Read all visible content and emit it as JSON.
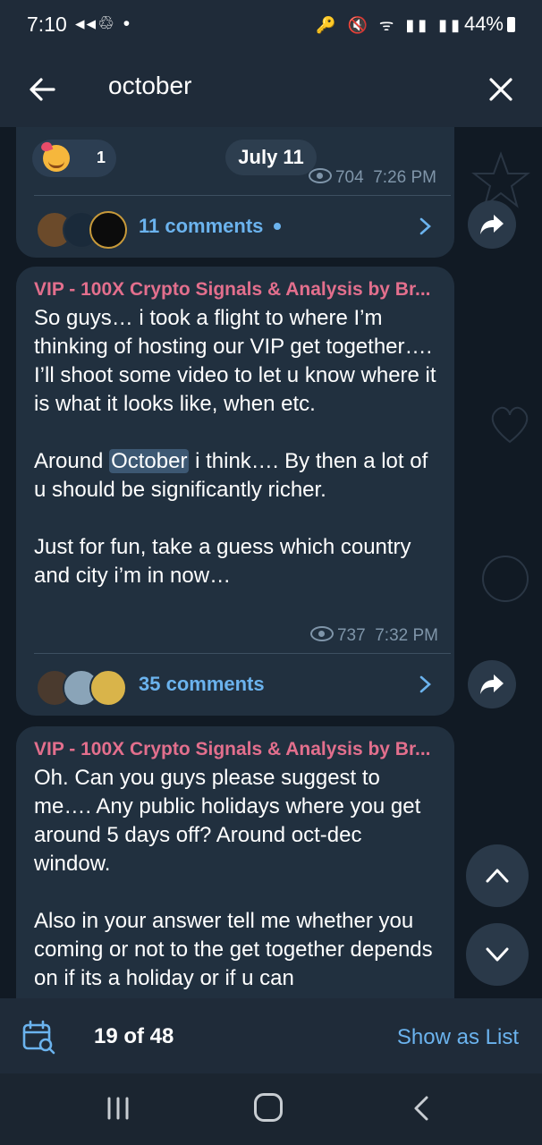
{
  "status_bar": {
    "time": "7:10",
    "left_icons": "◂◂♲ •",
    "right_icons": "🔑 🔇 ᯤ ▮▮ ▮▮",
    "battery": "44%"
  },
  "top_bar": {
    "search_query": "october"
  },
  "messages": [
    {
      "reaction_emoji": "smiling-face-with-hearts",
      "reaction_count": "1",
      "date_label": "July 11",
      "views": "704",
      "time": "7:26 PM",
      "comments_label": "11 comments"
    },
    {
      "sender": "VIP - 100X Crypto Signals & Analysis by Br...",
      "text_part1": "So guys… i took a flight to where I’m thinking of hosting our VIP get together…. I’ll shoot some video to let u know where it is what it looks like, when etc.\n\nAround ",
      "text_highlight": "October",
      "text_part2": " i think…. By then a lot of u should be significantly richer.\n\nJust for fun, take a guess which country and city i’m in now…",
      "views": "737",
      "time": "7:32 PM",
      "comments_label": "35 comments"
    },
    {
      "sender": "VIP - 100X Crypto Signals & Analysis by Br...",
      "text": "Oh. Can you guys please suggest to me…. Any public holidays where you get around 5 days off? Around oct-dec window.\n\nAlso in your answer tell me whether you coming or not to the get together depends on if its a holiday or if u can"
    }
  ],
  "bottom_bar": {
    "counter": "19 of 48",
    "show_as_list": "Show as List"
  },
  "colors": {
    "accent": "#6bb3ee",
    "sender": "#e36f8d",
    "bubble": "#21303f",
    "bar": "#1f2b39"
  }
}
